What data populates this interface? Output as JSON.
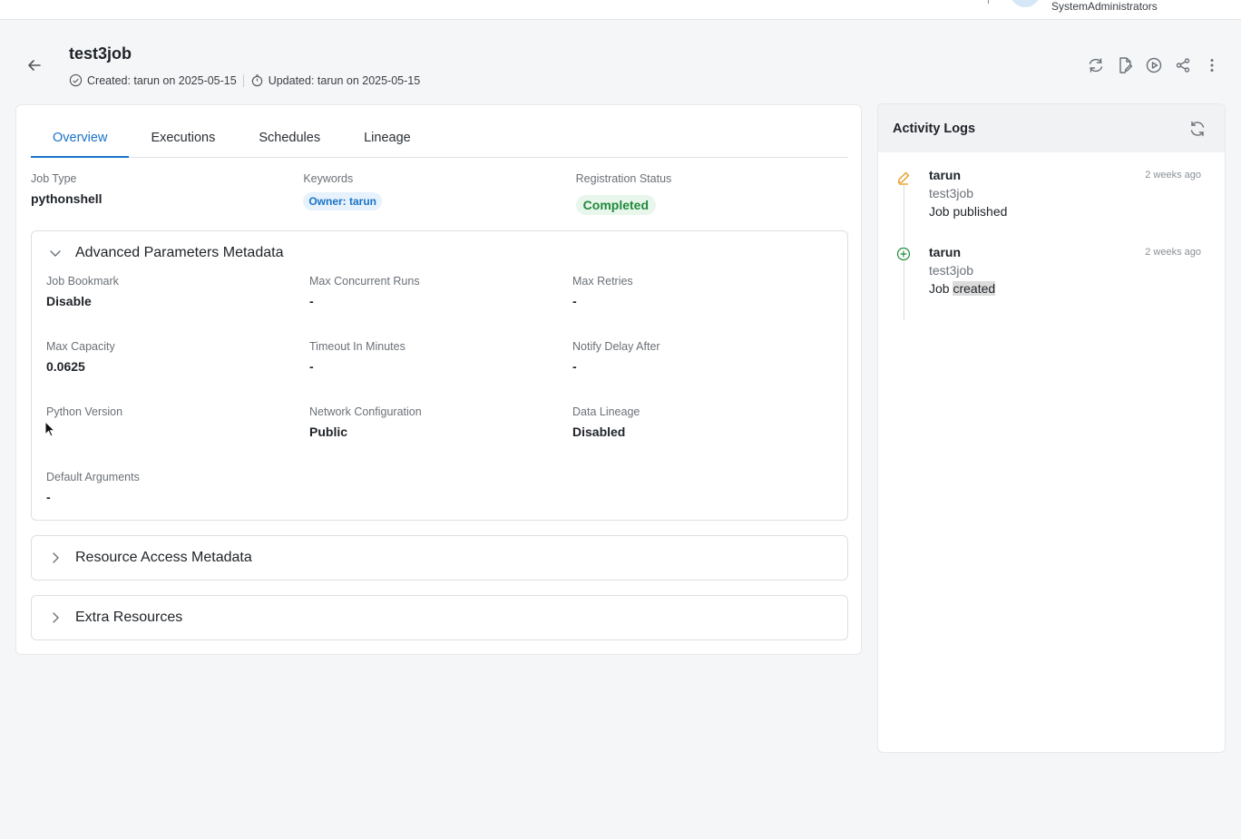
{
  "topbar": {
    "role": "SystemAdministrators"
  },
  "header": {
    "title": "test3job",
    "created": "Created: tarun on 2025-05-15",
    "updated": "Updated: tarun on 2025-05-15"
  },
  "tabs": [
    {
      "label": "Overview"
    },
    {
      "label": "Executions"
    },
    {
      "label": "Schedules"
    },
    {
      "label": "Lineage"
    }
  ],
  "summary": {
    "job_type_label": "Job Type",
    "job_type_value": "pythonshell",
    "keywords_label": "Keywords",
    "keyword_chip": "Owner: tarun",
    "registration_label": "Registration Status",
    "registration_value": "Completed"
  },
  "advanced": {
    "title": "Advanced Parameters Metadata",
    "fields": [
      {
        "label": "Job Bookmark",
        "value": "Disable"
      },
      {
        "label": "Max Concurrent Runs",
        "value": "-"
      },
      {
        "label": "Max Retries",
        "value": "-"
      },
      {
        "label": "Max Capacity",
        "value": "0.0625"
      },
      {
        "label": "Timeout In Minutes",
        "value": "-"
      },
      {
        "label": "Notify Delay After",
        "value": "-"
      },
      {
        "label": "Python Version",
        "value": ""
      },
      {
        "label": "Network Configuration",
        "value": "Public"
      },
      {
        "label": "Data Lineage",
        "value": "Disabled"
      },
      {
        "label": "Default Arguments",
        "value": "-"
      }
    ]
  },
  "resource_access": {
    "title": "Resource Access Metadata"
  },
  "extra_resources": {
    "title": "Extra Resources"
  },
  "activity": {
    "title": "Activity Logs",
    "logs": [
      {
        "user": "tarun",
        "job": "test3job",
        "msg_prefix": "Job ",
        "msg_action": "published",
        "time": "2 weeks ago",
        "icon": "edit-icon"
      },
      {
        "user": "tarun",
        "job": "test3job",
        "msg_prefix": "Job ",
        "msg_action": "created",
        "time": "2 weeks ago",
        "icon": "plus-circle-icon"
      }
    ]
  },
  "colors": {
    "accent": "#1a73c7",
    "success": "#208a3c",
    "edit": "#e89a1c"
  }
}
